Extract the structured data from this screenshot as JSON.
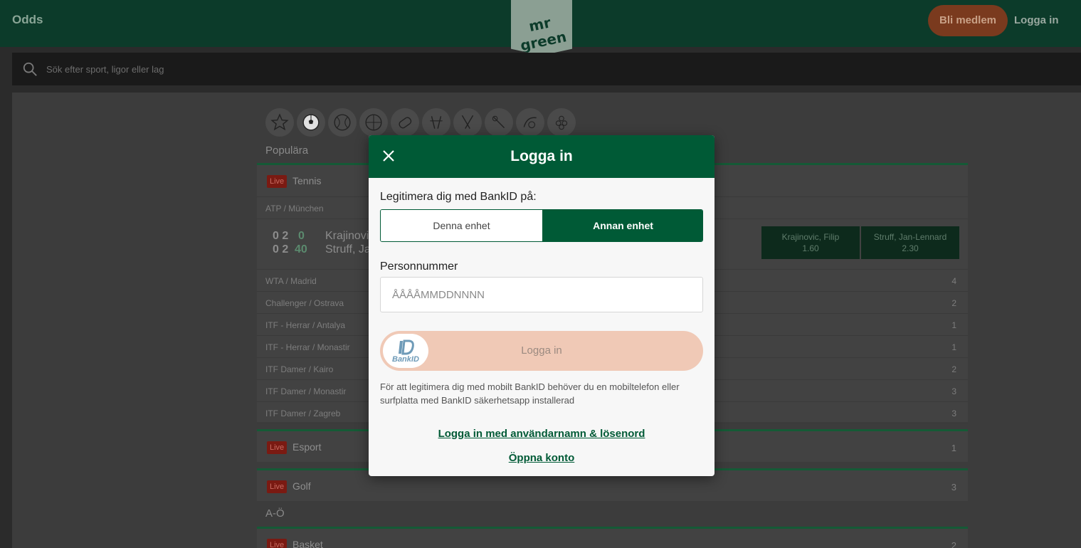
{
  "header": {
    "odds_label": "Odds",
    "logo_text": "mr green",
    "join_label": "Bli medlem",
    "login_label": "Logga in"
  },
  "search": {
    "placeholder": "Sök efter sport, ligor eller lag"
  },
  "sport_icons": [
    "star-icon",
    "football-icon",
    "tennis-icon",
    "basketball-icon",
    "esport-icon",
    "golf-icon",
    "ice-hockey-icon",
    "badminton-icon",
    "volleyball-icon",
    "snooker-icon"
  ],
  "popular": {
    "heading": "Populära",
    "tennis": {
      "live": "Live",
      "title": "Tennis",
      "league": "ATP / München",
      "score_p1": "0 2",
      "score_p1_game": "0",
      "score_p2": "0 2",
      "score_p2_game": "40",
      "player1": "Krajinovi",
      "player2": "Struff, Ja",
      "odds": [
        {
          "name": "Krajinovic, Filip",
          "value": "1.60"
        },
        {
          "name": "Struff, Jan-Lennard",
          "value": "2.30"
        }
      ],
      "leagues": [
        {
          "name": "WTA / Madrid",
          "count": "4"
        },
        {
          "name": "Challenger / Ostrava",
          "count": "2"
        },
        {
          "name": "ITF - Herrar / Antalya",
          "count": "1"
        },
        {
          "name": "ITF - Herrar / Monastir",
          "count": "1"
        },
        {
          "name": "ITF Damer / Kairo",
          "count": "2"
        },
        {
          "name": "ITF Damer / Monastir",
          "count": "3"
        },
        {
          "name": "ITF Damer / Zagreb",
          "count": "3"
        }
      ]
    },
    "esport": {
      "live": "Live",
      "title": "Esport",
      "count": "1"
    },
    "golf": {
      "live": "Live",
      "title": "Golf",
      "count": "3"
    }
  },
  "az": {
    "heading": "A-Ö",
    "basket": {
      "live": "Live",
      "title": "Basket",
      "count": "2"
    }
  },
  "modal": {
    "title": "Logga in",
    "bank_label": "Legitimera dig med BankID på:",
    "seg_this": "Denna enhet",
    "seg_other": "Annan enhet",
    "pn_label": "Personnummer",
    "pn_placeholder": "ÅÅÅÅMMDDNNNN",
    "login_button": "Logga in",
    "bankid_text": "BankID",
    "info": "För att legitimera dig med mobilt BankID behöver du en mobiltelefon eller surfplatta med BankID säkerhetsapp installerad",
    "link_userpass": "Logga in med användarnamn & lösenord",
    "link_open": "Öppna konto"
  },
  "colors": {
    "brand_green": "#005a36",
    "header_bg": "#0c3b2a",
    "live_red": "#7a1a12",
    "login_btn": "#f0c9b6"
  }
}
